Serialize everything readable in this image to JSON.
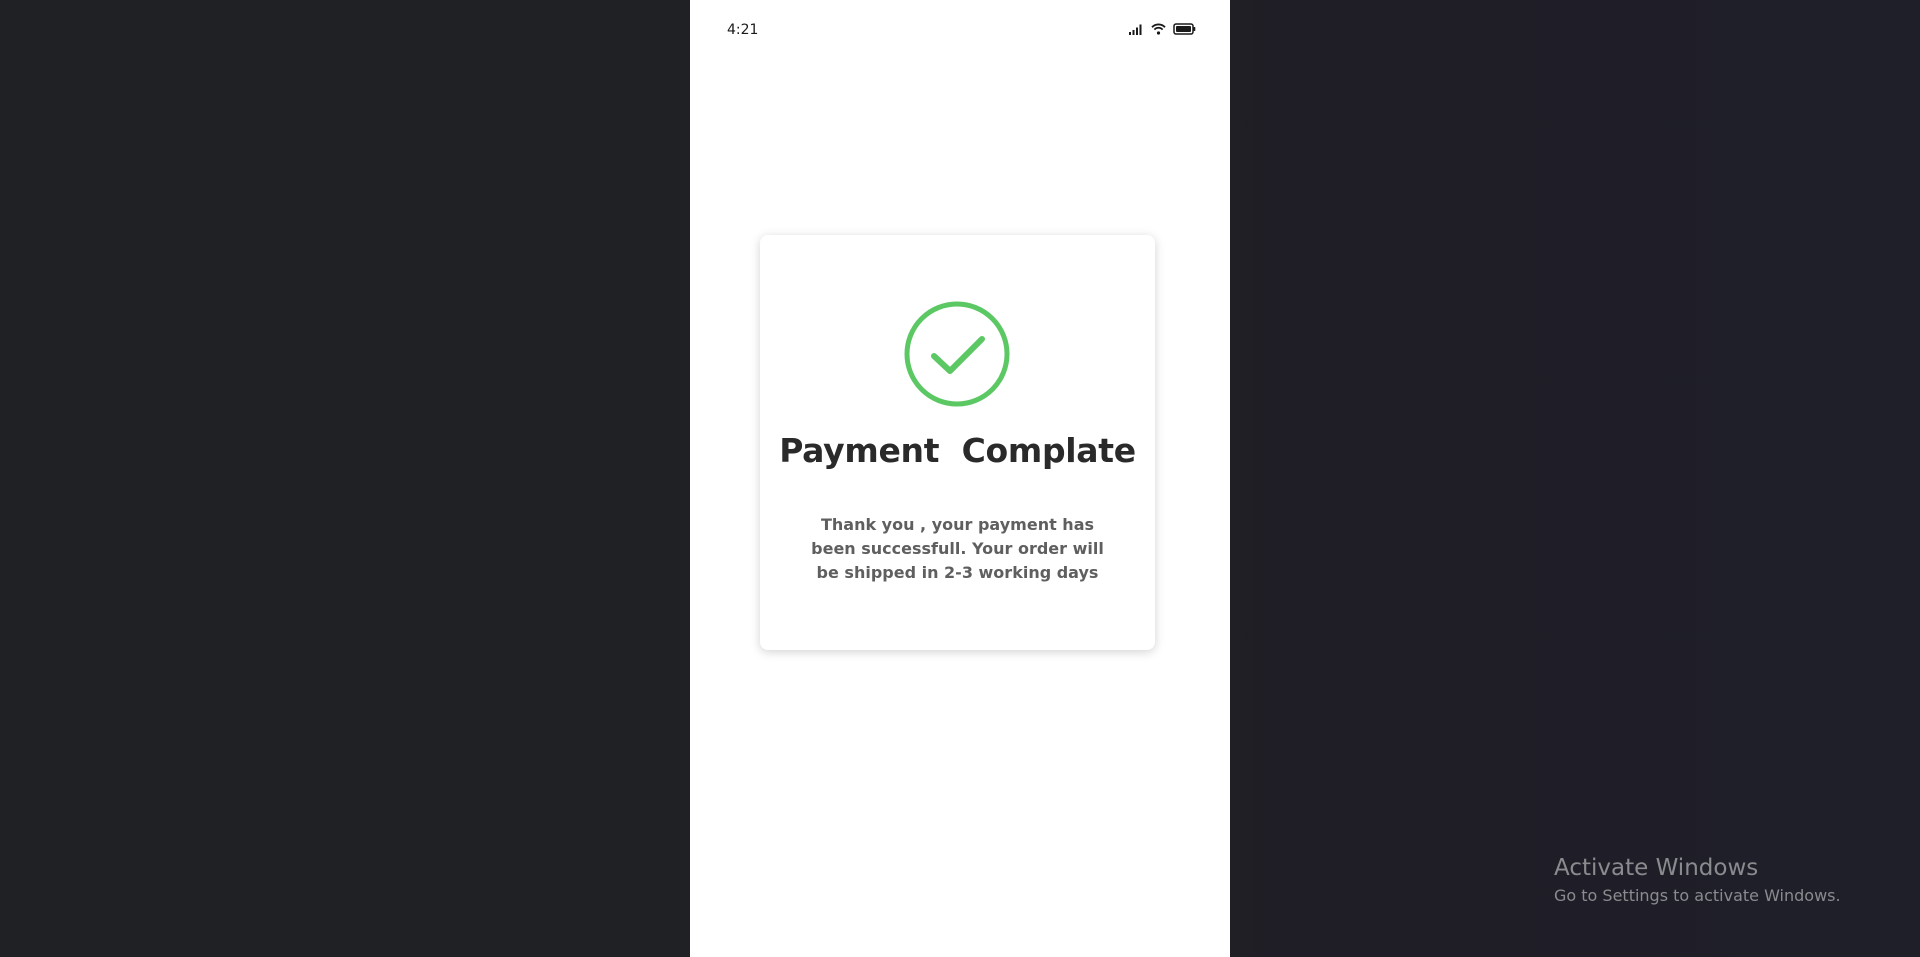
{
  "status_bar": {
    "time": "4:21",
    "icons": [
      "signal-icon",
      "wifi-icon",
      "battery-icon"
    ]
  },
  "card": {
    "icon": "check-circle-icon",
    "title": "Payment  Complate",
    "message": "Thank you , your payment has been successfull. Your order will be shipped in 2-3 working days"
  },
  "watermark": {
    "title": "Activate Windows",
    "subtitle": "Go to Settings to activate Windows."
  },
  "colors": {
    "success": "#5cc864",
    "background": "#202124",
    "card": "#ffffff"
  }
}
